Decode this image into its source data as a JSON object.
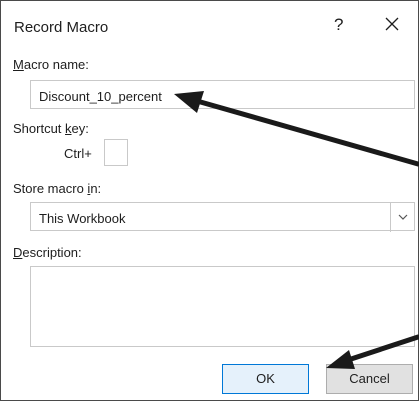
{
  "dialog": {
    "title": "Record Macro",
    "help_glyph": "?",
    "close_icon": "close-icon"
  },
  "macro_name": {
    "label_key": "M",
    "label_rest": "acro name:",
    "value": "Discount_10_percent"
  },
  "shortcut_key": {
    "label_pre": "Shortcut ",
    "label_key": "k",
    "label_post": "ey:",
    "prefix": "Ctrl+",
    "value": ""
  },
  "store_macro": {
    "label_pre": "Store macro ",
    "label_key": "i",
    "label_post": "n:",
    "selected": "This Workbook"
  },
  "description": {
    "label_key": "D",
    "label_rest": "escription:",
    "value": ""
  },
  "buttons": {
    "ok": "OK",
    "cancel": "Cancel"
  },
  "colors": {
    "arrow": "#1a1a1a",
    "ok_border": "#0078d7",
    "field_border": "#c9c9c9"
  }
}
